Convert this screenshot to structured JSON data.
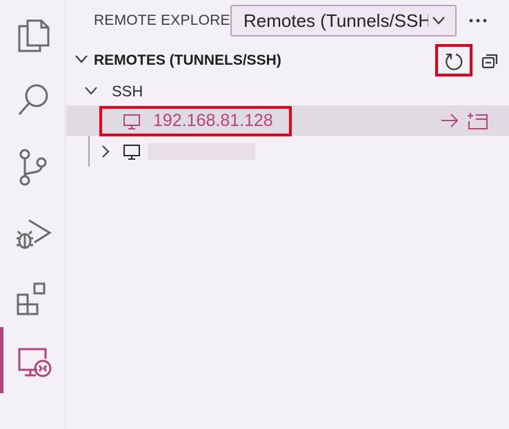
{
  "colors": {
    "accent": "#b7457d",
    "highlight_border": "#e3001b",
    "icon": "#6b6b6b"
  },
  "activity_bar": {
    "items": [
      {
        "icon": "explorer-files-icon"
      },
      {
        "icon": "search-icon"
      },
      {
        "icon": "source-control-icon"
      },
      {
        "icon": "run-and-debug-icon"
      },
      {
        "icon": "extensions-icon"
      },
      {
        "icon": "remote-explorer-icon",
        "active": true
      }
    ]
  },
  "sidebar": {
    "title": "REMOTE EXPLORER",
    "dropdown_value": "Remotes (Tunnels/SSH",
    "more_icon": "ellipsis-icon"
  },
  "section": {
    "title": "REMOTES (TUNNELS/SSH)",
    "actions": [
      "refresh-icon",
      "collapse-all-icon"
    ]
  },
  "tree": {
    "group_label": "SSH",
    "hosts": [
      {
        "label": "192.168.81.128",
        "selected": true,
        "actions": [
          "connect-arrow-icon",
          "open-new-window-icon"
        ]
      },
      {
        "label": "",
        "redacted": true
      }
    ]
  }
}
